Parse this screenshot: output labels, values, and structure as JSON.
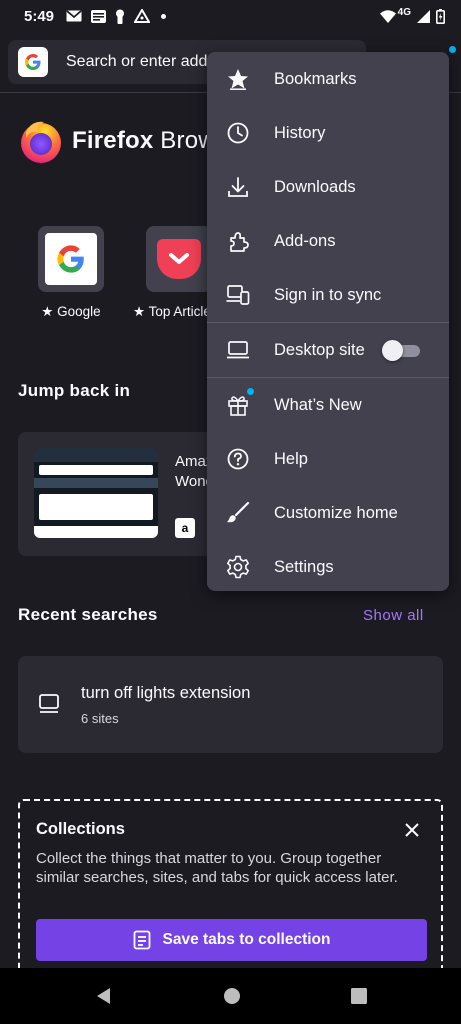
{
  "status": {
    "time": "5:49",
    "network": "4G"
  },
  "toolbar": {
    "search_placeholder": "Search or enter address"
  },
  "brand": {
    "name_bold": "Firefox",
    "name_rest": " Browser"
  },
  "top_sites": [
    {
      "label": "Google"
    },
    {
      "label": "Top Articles"
    }
  ],
  "jump_back": {
    "title": "Jump back in",
    "card_title": "Amazon.com: Wonder Woman"
  },
  "recent_searches": {
    "title": "Recent searches",
    "show_all": "Show all",
    "item_title": "turn off lights extension",
    "item_sub": "6 sites"
  },
  "collections": {
    "title": "Collections",
    "description": "Collect the things that matter to you. Group together similar searches, sites, and tabs for quick access later.",
    "button": "Save tabs to collection"
  },
  "menu": {
    "items": [
      {
        "label": "Bookmarks",
        "icon": "bookmark-star-icon"
      },
      {
        "label": "History",
        "icon": "clock-icon"
      },
      {
        "label": "Downloads",
        "icon": "download-icon"
      },
      {
        "label": "Add-ons",
        "icon": "puzzle-icon"
      },
      {
        "label": "Sign in to sync",
        "icon": "sync-devices-icon"
      },
      {
        "label": "Desktop site",
        "icon": "laptop-icon",
        "toggle": false
      },
      {
        "label": "What’s New",
        "icon": "gift-icon"
      },
      {
        "label": "Help",
        "icon": "help-icon"
      },
      {
        "label": "Customize home",
        "icon": "brush-icon"
      },
      {
        "label": "Settings",
        "icon": "gear-icon"
      }
    ]
  },
  "colors": {
    "background": "#1c1b22",
    "card": "#2b2a33",
    "menu": "#42414d",
    "accent": "#7542e5",
    "link": "#a677ff",
    "notification_dot": "#00b3f4"
  }
}
